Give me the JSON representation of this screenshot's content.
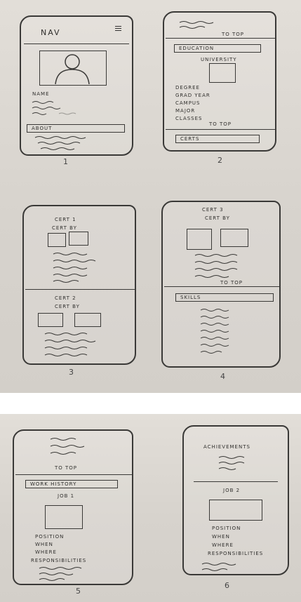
{
  "frames": [
    {
      "number": "1",
      "nav": "NAV",
      "name_label": "NAME",
      "about": "ABOUT"
    },
    {
      "number": "2",
      "to_top": "TO TOP",
      "education": "EDUCATION",
      "university": "UNIVERSITY",
      "fields": [
        "DEGREE",
        "GRAD YEAR",
        "CAMPUS",
        "MAJOR",
        "CLASSES"
      ],
      "to_top_2": "TO TOP",
      "certs": "CERTS"
    },
    {
      "number": "3",
      "cert1": "CERT 1",
      "cert1_by": "CERT BY",
      "cert2": "CERT 2",
      "cert2_by": "CERT BY"
    },
    {
      "number": "4",
      "cert3": "CERT 3",
      "cert3_by": "CERT BY",
      "to_top": "TO TOP",
      "skills": "SKILLS"
    },
    {
      "number": "5",
      "to_top": "TO TOP",
      "work_history": "WORK HISTORY",
      "job1": "JOB 1",
      "fields": [
        "POSITION",
        "WHEN",
        "WHERE",
        "RESPONSIBILITIES"
      ]
    },
    {
      "number": "6",
      "achievements": "ACHIEVEMENTS",
      "job2": "JOB 2",
      "fields": [
        "POSITION",
        "WHEN",
        "WHERE",
        "RESPONSIBILITIES"
      ]
    }
  ]
}
